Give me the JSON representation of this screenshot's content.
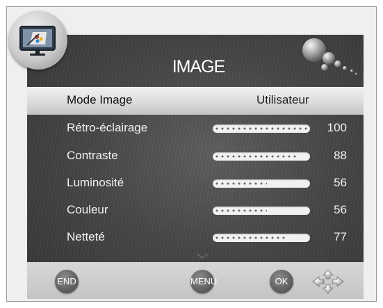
{
  "header": {
    "title": "IMAGE",
    "icon": "tv-picture-icon"
  },
  "menu": {
    "selected": {
      "label": "Mode Image",
      "value": "Utilisateur"
    },
    "items": [
      {
        "label": "Rétro-éclairage",
        "value": "100",
        "level": 100
      },
      {
        "label": "Contraste",
        "value": "88",
        "level": 88
      },
      {
        "label": "Luminosité",
        "value": "56",
        "level": 56
      },
      {
        "label": "Couleur",
        "value": "56",
        "level": 56
      },
      {
        "label": "Netteté",
        "value": "77",
        "level": 77
      }
    ]
  },
  "footer": {
    "end": "END",
    "menu": "MENU",
    "ok": "OK",
    "nav_icon": "navigation-arrows-icon"
  },
  "colors": {
    "osd_background": "#474747",
    "selected_row": "#dcdcdc",
    "bottom_bar": "#cfcfcf",
    "text_light": "#f2f2f2"
  }
}
